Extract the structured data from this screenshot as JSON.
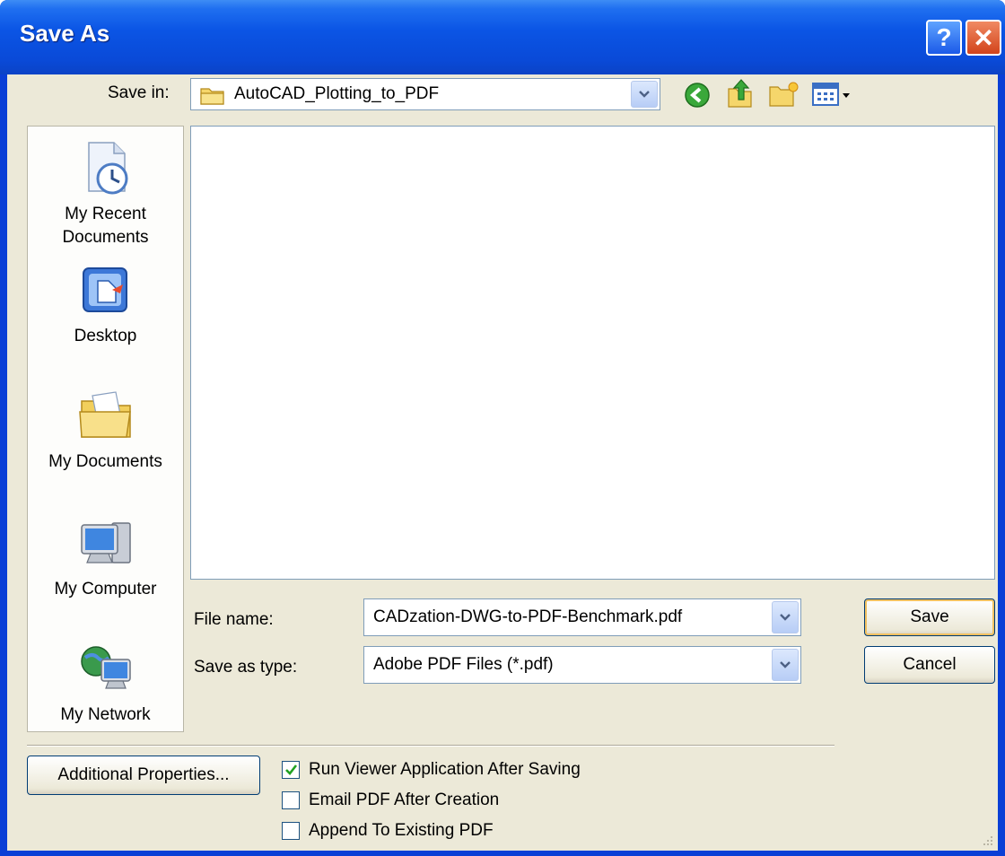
{
  "window": {
    "title": "Save As"
  },
  "titlebar": {
    "help_glyph": "?",
    "close_glyph": "✕"
  },
  "save_in": {
    "label": "Save in:",
    "value": "AutoCAD_Plotting_to_PDF"
  },
  "toolbar": {
    "icons": [
      "back-icon",
      "up-folder-icon",
      "new-folder-icon",
      "views-menu-icon"
    ]
  },
  "places": [
    {
      "label_lines": [
        "My Recent",
        "Documents"
      ],
      "icon": "recent-documents-icon"
    },
    {
      "label_lines": [
        "Desktop"
      ],
      "icon": "desktop-icon"
    },
    {
      "label_lines": [
        "My Documents"
      ],
      "icon": "my-documents-icon"
    },
    {
      "label_lines": [
        "My Computer"
      ],
      "icon": "my-computer-icon"
    },
    {
      "label_lines": [
        "My Network"
      ],
      "icon": "my-network-icon"
    }
  ],
  "file_name": {
    "label": "File name:",
    "value": "CADzation-DWG-to-PDF-Benchmark.pdf"
  },
  "save_as_type": {
    "label": "Save as type:",
    "value": "Adobe PDF Files (*.pdf)"
  },
  "buttons": {
    "save": "Save",
    "cancel": "Cancel",
    "additional": "Additional Properties..."
  },
  "options": [
    {
      "label": "Run Viewer Application After Saving",
      "checked": true
    },
    {
      "label": "Email PDF After Creation",
      "checked": false
    },
    {
      "label": "Append To Existing PDF",
      "checked": false
    }
  ],
  "colors": {
    "title_blue": "#0a4ad8",
    "dialog_face": "#ece9d8",
    "close_red": "#d2431b"
  }
}
